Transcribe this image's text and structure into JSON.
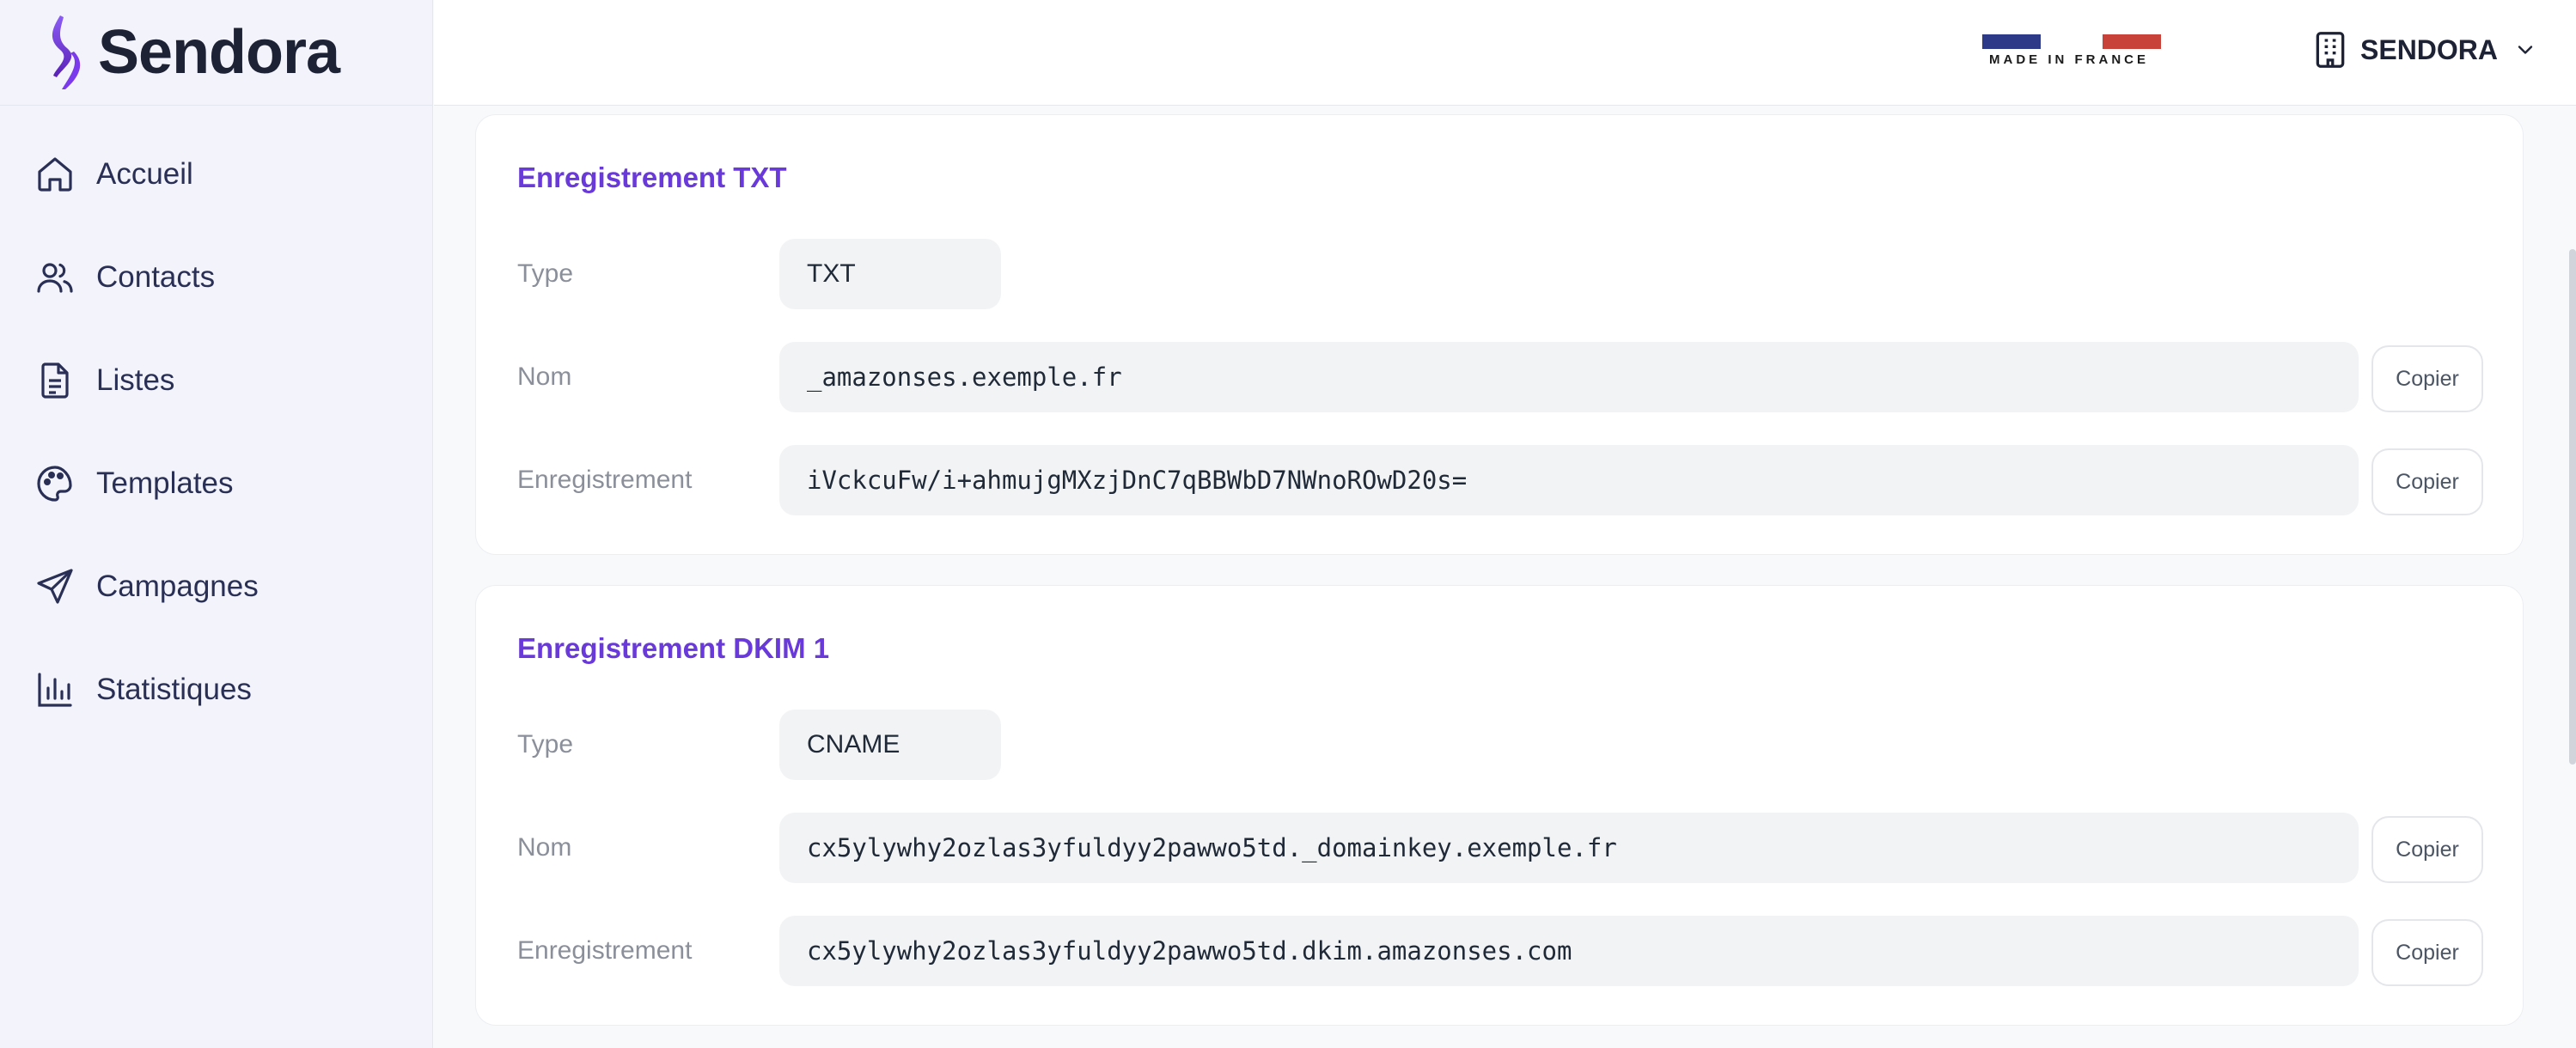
{
  "brand": {
    "name": "Sendora",
    "accent": "#6a39d9"
  },
  "sidebar": {
    "items": [
      {
        "label": "Accueil",
        "icon": "home-icon"
      },
      {
        "label": "Contacts",
        "icon": "users-icon"
      },
      {
        "label": "Listes",
        "icon": "document-icon"
      },
      {
        "label": "Templates",
        "icon": "palette-icon"
      },
      {
        "label": "Campagnes",
        "icon": "send-icon"
      },
      {
        "label": "Statistiques",
        "icon": "bar-chart-icon"
      }
    ]
  },
  "header": {
    "made_in_france": "MADE IN FRANCE",
    "org_name": "SENDORA"
  },
  "records": [
    {
      "title": "Enregistrement TXT",
      "type_label": "Type",
      "type_value": "TXT",
      "name_label": "Nom",
      "name_value": "_amazonses.exemple.fr",
      "record_label": "Enregistrement",
      "record_value": "iVckcuFw/i+ahmujgMXzjDnC7qBBWbD7NWnoROwD20s=",
      "copy_label": "Copier"
    },
    {
      "title": "Enregistrement DKIM 1",
      "type_label": "Type",
      "type_value": "CNAME",
      "name_label": "Nom",
      "name_value": "cx5ylywhy2ozlas3yfuldyy2pawwo5td._domainkey.exemple.fr",
      "record_label": "Enregistrement",
      "record_value": "cx5ylywhy2ozlas3yfuldyy2pawwo5td.dkim.amazonses.com",
      "copy_label": "Copier"
    }
  ]
}
